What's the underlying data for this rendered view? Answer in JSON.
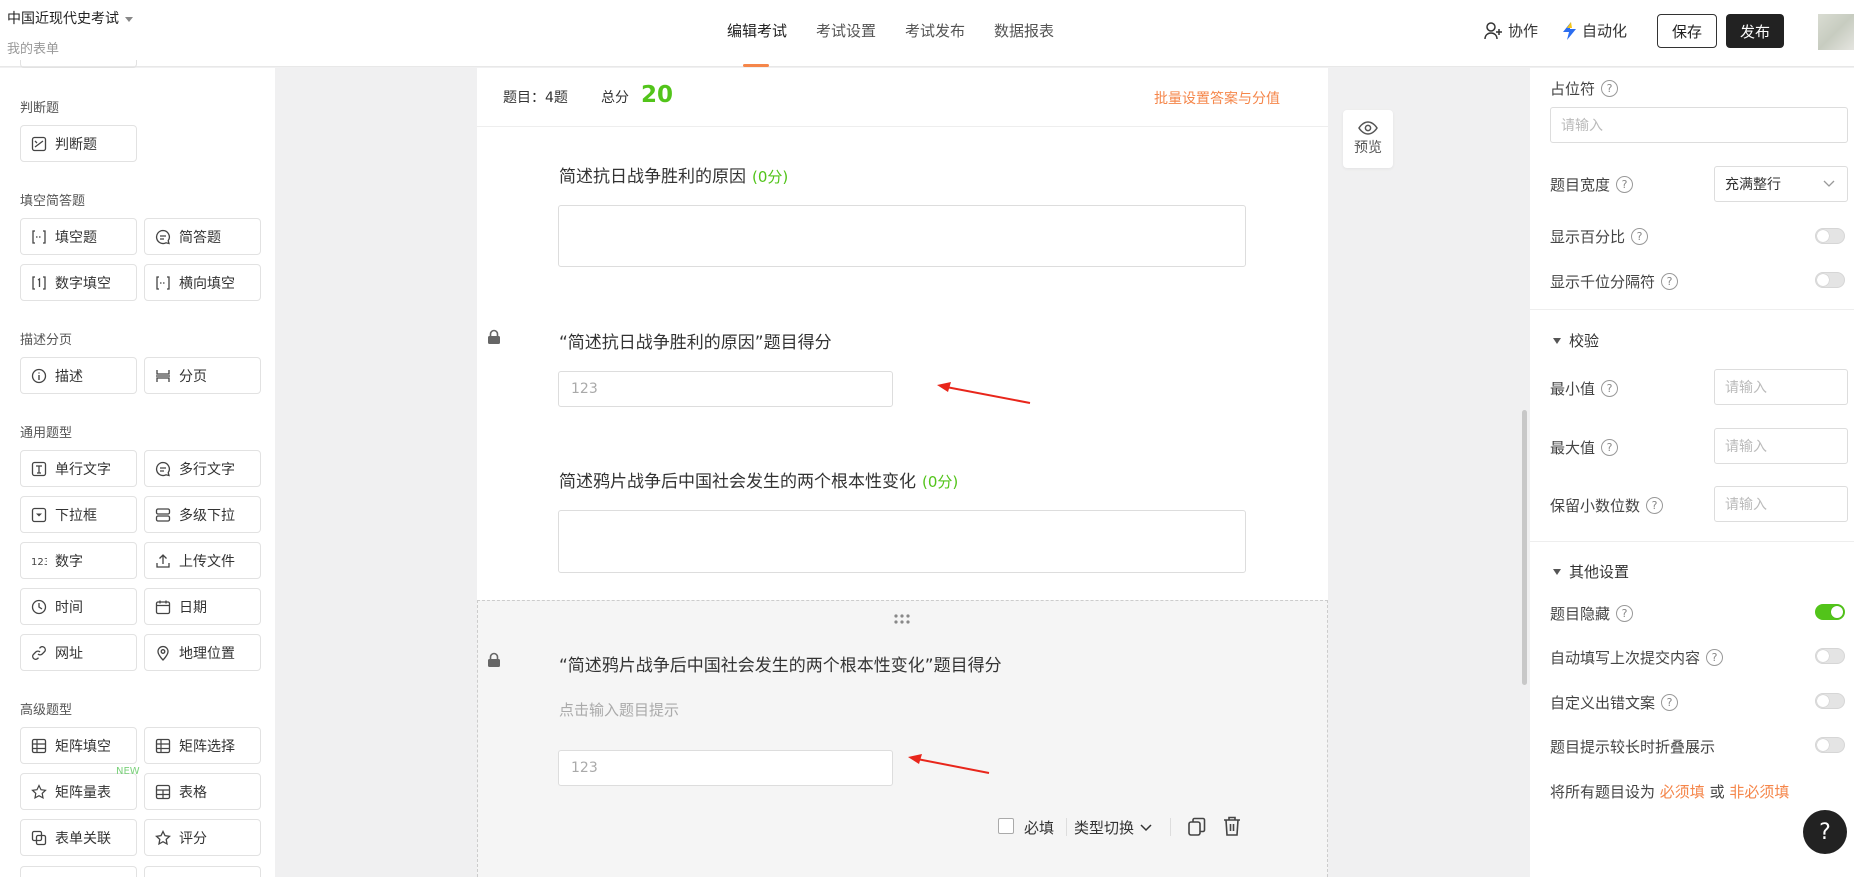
{
  "header": {
    "form_title": "中国近现代史考试",
    "subtitle": "我的表单",
    "tabs": [
      "编辑考试",
      "考试设置",
      "考试发布",
      "数据报表"
    ],
    "collab": "协作",
    "automation": "自动化",
    "save": "保存",
    "publish": "发布",
    "accent_color": "#f5864a"
  },
  "left": {
    "sections": [
      {
        "title": "判断题",
        "items": [
          "判断题"
        ]
      },
      {
        "title": "填空简答题",
        "items": [
          "填空题",
          "简答题",
          "数字填空",
          "横向填空"
        ]
      },
      {
        "title": "描述分页",
        "items": [
          "描述",
          "分页"
        ]
      },
      {
        "title": "通用题型",
        "items": [
          "单行文字",
          "多行文字",
          "下拉框",
          "多级下拉",
          "数字",
          "上传文件",
          "时间",
          "日期",
          "网址",
          "地理位置"
        ]
      },
      {
        "title": "高级题型",
        "items": [
          "矩阵填空",
          "矩阵选择",
          "矩阵量表",
          "表格",
          "表单关联",
          "评分"
        ]
      }
    ],
    "new_badge": "NEW"
  },
  "canvas": {
    "count_label": "题目：4题",
    "total_label": "总分",
    "total_value": "20",
    "batch_link": "批量设置答案与分值",
    "q1_title": "简述抗日战争胜利的原因",
    "q1_score": "(0分)",
    "q2_title": "“简述抗日战争胜利的原因”题目得分",
    "q2_placeholder": "123",
    "q3_title": "简述鸦片战争后中国社会发生的两个根本性变化",
    "q3_score": "(0分)",
    "q4_title": "“简述鸦片战争后中国社会发生的两个根本性变化”题目得分",
    "q4_hint": "点击输入题目提示",
    "q4_placeholder": "123",
    "required": "必填",
    "type_switch": "类型切换",
    "preview": "预览",
    "score_color": "#52c41a"
  },
  "right": {
    "placeholder_label": "占位符",
    "placeholder_input": "请输入",
    "width_label": "题目宽度",
    "width_value": "充满整行",
    "show_percent": "显示百分比",
    "show_thousands": "显示千位分隔符",
    "validation": "校验",
    "min_label": "最小值",
    "max_label": "最大值",
    "decimals_label": "保留小数位数",
    "input_placeholder": "请输入",
    "other_settings": "其他设置",
    "hide_question": "题目隐藏",
    "autofill": "自动填写上次提交内容",
    "custom_error": "自定义出错文案",
    "fold_hint": "题目提示较长时折叠展示",
    "set_all_prefix": "将所有题目设为",
    "required_link": "必须填",
    "or": "或",
    "optional_link": "非必须填",
    "help": "?",
    "toggle_on_color": "#52c41a"
  }
}
